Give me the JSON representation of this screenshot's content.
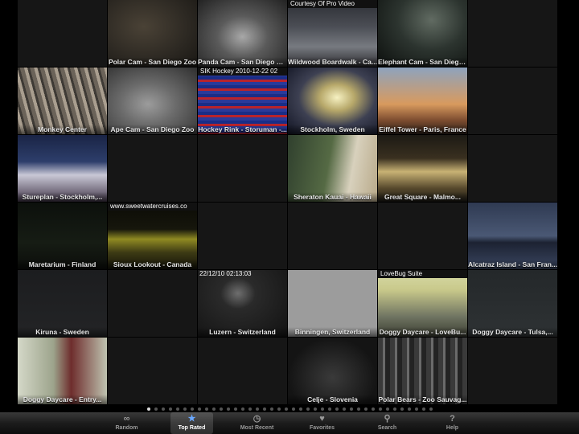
{
  "tiles": [
    {
      "caption": "",
      "scene": "s-dark"
    },
    {
      "caption": "Polar Cam - San Diego Zoo",
      "scene": "s-zoo1"
    },
    {
      "caption": "Panda Cam - San Diego Zoo",
      "scene": "s-panda"
    },
    {
      "caption": "Wildwood Boardwalk - Ca...",
      "scene": "s-board",
      "overlay": "Courtesy Of Pro Video"
    },
    {
      "caption": "Elephant Cam - San Diego...",
      "scene": "s-eleph"
    },
    {
      "caption": "",
      "scene": "s-dark"
    },
    {
      "caption": "Monkey Center",
      "scene": "s-monkey"
    },
    {
      "caption": "Ape Cam - San Diego Zoo",
      "scene": "s-ape"
    },
    {
      "caption": "Hockey Rink - Storuman -...",
      "scene": "s-hockey",
      "overlay": "SIK Hockey 2010-12-22 02"
    },
    {
      "caption": "Stockholm, Sweden",
      "scene": "s-stock"
    },
    {
      "caption": "Eiffel Tower - Paris, France",
      "scene": "s-eiffel"
    },
    {
      "caption": "",
      "scene": "s-dark"
    },
    {
      "caption": "Stureplan - Stockholm,...",
      "scene": "s-sture"
    },
    {
      "caption": "",
      "scene": "s-dark"
    },
    {
      "caption": "",
      "scene": "s-dark"
    },
    {
      "caption": "Sheraton Kauai - Hawaii",
      "scene": "s-kauai"
    },
    {
      "caption": "Great Square - Malmo...",
      "scene": "s-square"
    },
    {
      "caption": "",
      "scene": "s-dark"
    },
    {
      "caption": "Maretarium - Finland",
      "scene": "s-mare"
    },
    {
      "caption": "Sioux Lookout - Canada",
      "scene": "s-sioux",
      "overlay": "www.sweetwatercruises.co"
    },
    {
      "caption": "",
      "scene": "s-dark"
    },
    {
      "caption": "",
      "scene": "s-dark"
    },
    {
      "caption": "",
      "scene": "s-dark"
    },
    {
      "caption": "Alcatraz Island - San Fran...",
      "scene": "s-alcatraz"
    },
    {
      "caption": "Kiruna - Sweden",
      "scene": "s-kiruna"
    },
    {
      "caption": "",
      "scene": "s-dark"
    },
    {
      "caption": "Luzern - Switzerland",
      "scene": "s-luzern",
      "overlay": "22/12/10 02:13:03"
    },
    {
      "caption": "Binningen, Switzerland",
      "scene": "s-binn"
    },
    {
      "caption": "Doggy Daycare - LoveBu...",
      "scene": "s-love",
      "overlay": "LoveBug Suite"
    },
    {
      "caption": "Doggy Daycare - Tulsa,...",
      "scene": "s-tulsa"
    },
    {
      "caption": "Doggy Daycare - Entry...",
      "scene": "s-entry"
    },
    {
      "caption": "",
      "scene": "s-dark"
    },
    {
      "caption": "",
      "scene": "s-dark"
    },
    {
      "caption": "Celje - Slovenia",
      "scene": "s-celje"
    },
    {
      "caption": "Polar Bears - Zoo Sauvag...",
      "scene": "s-polar"
    },
    {
      "caption": "",
      "scene": "s-dark"
    }
  ],
  "pager": {
    "count": 40,
    "active_index": 0
  },
  "tabbar": {
    "items": [
      {
        "name": "random",
        "label": "Random",
        "icon": "∞",
        "icon_name": "infinity-icon"
      },
      {
        "name": "top-rated",
        "label": "Top Rated",
        "icon": "★",
        "icon_name": "star-icon",
        "active": true
      },
      {
        "name": "most-recent",
        "label": "Most Recent",
        "icon": "◷",
        "icon_name": "clock-icon"
      },
      {
        "name": "favorites",
        "label": "Favorites",
        "icon": "♥",
        "icon_name": "heart-icon"
      },
      {
        "name": "search",
        "label": "Search",
        "icon": "⚲",
        "icon_name": "search-icon"
      },
      {
        "name": "help",
        "label": "Help",
        "icon": "?",
        "icon_name": "help-icon"
      }
    ],
    "accent_color": "#6aa8ff"
  }
}
